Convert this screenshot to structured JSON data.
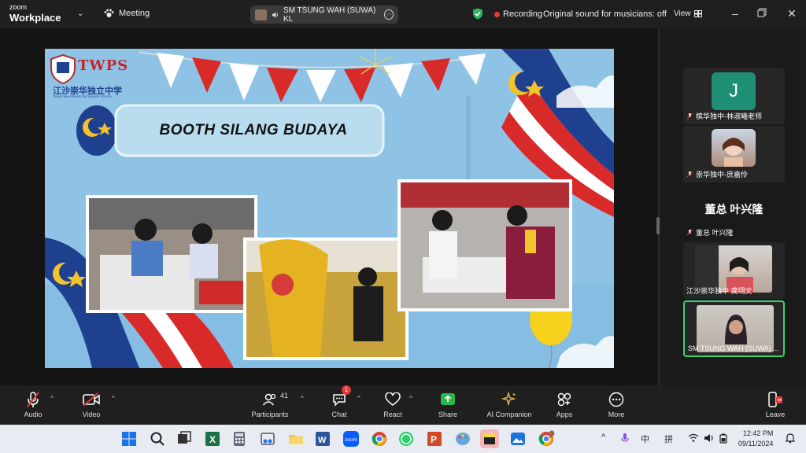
{
  "titlebar": {
    "brand_top": "zoom",
    "brand_bottom": "Workplace",
    "meeting_label": "Meeting",
    "active_speaker": "SM TSUNG WAH (SUWA) KL",
    "recording_label": "Recording",
    "original_sound": "Original sound for musicians: off",
    "view_label": "View"
  },
  "slide": {
    "logo_text": "TWPS",
    "logo_sub": "江沙崇华独立中学",
    "logo_tiny": "TSUNG WAH PRIVATE SECONDARY SCHOOL",
    "title": "BOOTH SILANG BUDAYA"
  },
  "participants": [
    {
      "name": "槟华独中-林淑曦老师",
      "avatar_letter": "J",
      "muted": true
    },
    {
      "name": "崇华独中-庶嘉伶",
      "muted": true
    },
    {
      "name": "董总 叶兴隆",
      "big_name": "董总 叶兴隆",
      "muted": true
    },
    {
      "name": "江沙崇华独中 龚翊文",
      "muted": false
    },
    {
      "name": "SM TSUNG WAH (SUWA) ...",
      "muted": false,
      "active": true
    }
  ],
  "toolbar": {
    "audio": "Audio",
    "video": "Video",
    "participants": "Participants",
    "participants_count": "41",
    "chat": "Chat",
    "chat_badge": "1",
    "react": "React",
    "share": "Share",
    "ai": "AI Companion",
    "apps": "Apps",
    "more": "More",
    "leave": "Leave"
  },
  "taskbar": {
    "ime1": "中",
    "ime2": "拼",
    "time": "12:42 PM",
    "date": "09/11/2024"
  },
  "colors": {
    "accent_green": "#3bd16f",
    "record_red": "#e23b3b",
    "slide_blue": "#8ec3e6"
  }
}
